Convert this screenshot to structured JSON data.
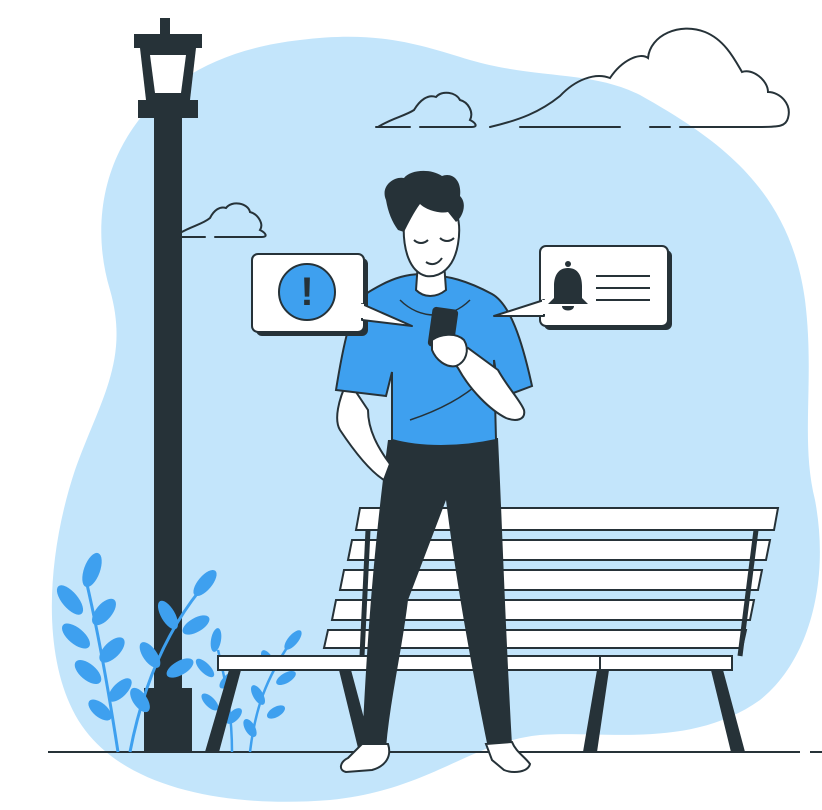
{
  "illustration": {
    "alert_bubble": {
      "glyph": "!",
      "icon": "exclamation-circle-icon"
    },
    "notification_bubble": {
      "icon": "bell-icon"
    }
  },
  "colors": {
    "background_blob": "#c3e5fb",
    "accent_blue": "#3ea0ef",
    "dark": "#263238",
    "white": "#ffffff",
    "skin": "#ffffff"
  }
}
